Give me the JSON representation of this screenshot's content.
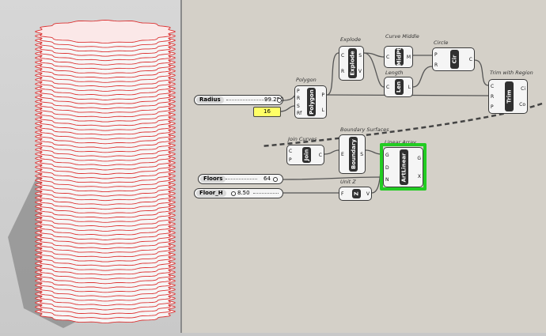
{
  "viewport": {
    "label": "rhino-viewport"
  },
  "sliders": {
    "radius": {
      "label": "Radius",
      "value": "99.250"
    },
    "floors": {
      "label": "Floors",
      "value": "64"
    },
    "floor_h": {
      "label": "Floor_H",
      "value": "8.50"
    }
  },
  "panel": {
    "value": "16"
  },
  "components": {
    "polygon": {
      "title": "Polygon",
      "nick": "Polygon",
      "inputs": [
        "P",
        "R",
        "S",
        "Rf"
      ],
      "outputs": [
        "P",
        "L"
      ]
    },
    "explode": {
      "title": "Explode",
      "nick": "Explode",
      "inputs": [
        "C",
        "R"
      ],
      "outputs": [
        "S",
        "V"
      ]
    },
    "midpt": {
      "title": "Curve Middle",
      "nick": "MidPt",
      "inputs": [
        "C"
      ],
      "outputs": [
        "M"
      ]
    },
    "length": {
      "title": "Length",
      "nick": "Len",
      "inputs": [
        "C"
      ],
      "outputs": [
        "L"
      ]
    },
    "circle": {
      "title": "Circle",
      "nick": "Cir",
      "inputs": [
        "P",
        "R"
      ],
      "outputs": [
        "C"
      ]
    },
    "trim": {
      "title": "Trim with Region",
      "nick": "Trim",
      "inputs": [
        "C",
        "R",
        "P"
      ],
      "outputs": [
        "Ci",
        "Co"
      ]
    },
    "join": {
      "title": "Join Curves",
      "nick": "Join",
      "inputs": [
        "C",
        "P"
      ],
      "outputs": [
        "C"
      ]
    },
    "boundary": {
      "title": "Boundary Surfaces",
      "nick": "Boundary",
      "inputs": [
        "E"
      ],
      "outputs": [
        "S"
      ]
    },
    "linear_array": {
      "title": "Linear Array",
      "nick": "ArtLinear",
      "inputs": [
        "G",
        "D",
        "N"
      ],
      "outputs": [
        "G",
        "X"
      ]
    },
    "unit_z": {
      "title": "Unit Z",
      "nick": "Z",
      "inputs": [
        "F"
      ],
      "outputs": [
        "V"
      ]
    }
  },
  "colors": {
    "canvas": "#d4d0c8",
    "selected": "#22cc22",
    "tower_edge": "#d33"
  }
}
